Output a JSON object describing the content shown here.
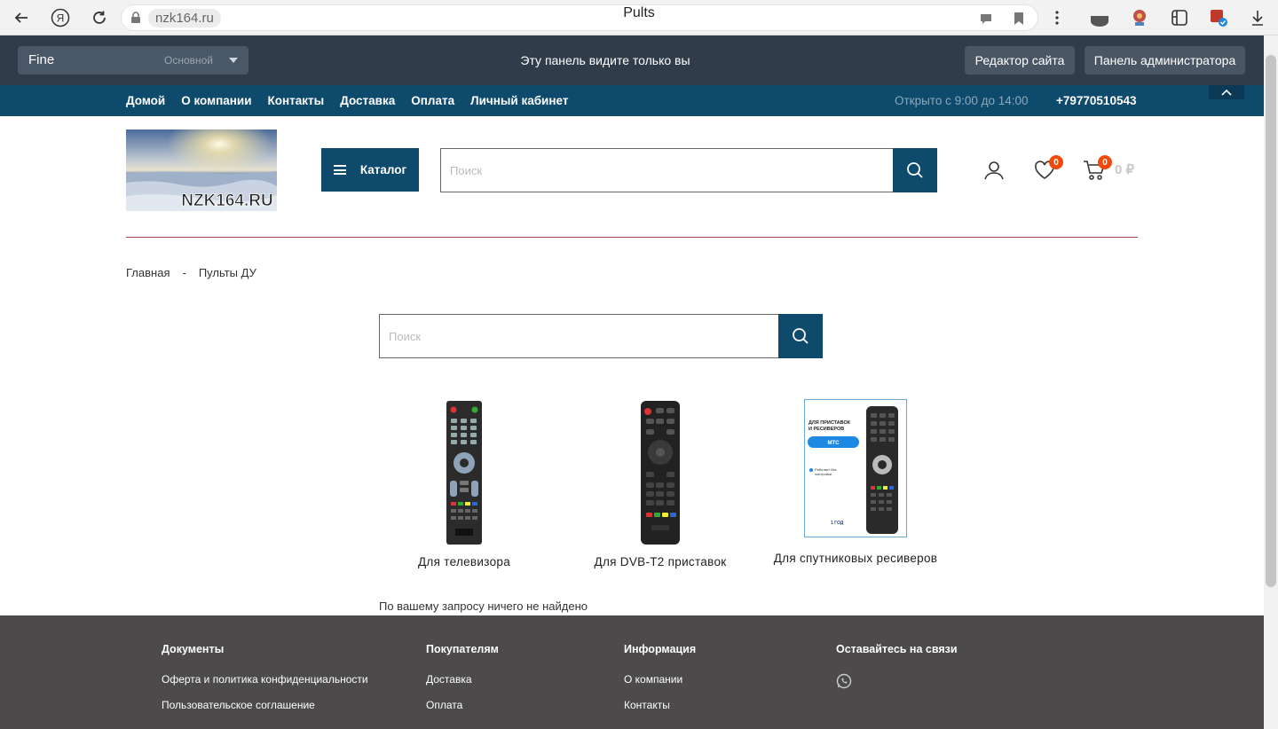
{
  "browser": {
    "domain": "nzk164.ru",
    "tab_title": "Pults"
  },
  "admin_bar": {
    "site_name": "Fine",
    "site_variant": "Основной",
    "message": "Эту панель видите только вы",
    "editor_button": "Редактор сайта",
    "admin_button": "Панель администратора"
  },
  "nav": {
    "links": [
      "Домой",
      "О компании",
      "Контакты",
      "Доставка",
      "Оплата",
      "Личный кабинет"
    ],
    "hours": "Открыто с 9:00 до 14:00",
    "phone": "+79770510543"
  },
  "header": {
    "logo_text": "NZK164.RU",
    "catalog_label": "Каталог",
    "search_placeholder": "Поиск",
    "wishlist_count": "0",
    "cart_count": "0",
    "cart_total": "0 ₽"
  },
  "breadcrumb": {
    "home": "Главная",
    "separator": "-",
    "current": "Пульты ДУ"
  },
  "category_search": {
    "placeholder": "Поиск"
  },
  "categories": [
    {
      "label": "Для телевизора"
    },
    {
      "label": "Для DVB-T2 приставок"
    },
    {
      "label": "Для спутниковых ресиверов"
    }
  ],
  "mts_card": {
    "line1": "ДЛЯ ПРИСТАВОК",
    "line2": "И РЕСИВЕРОВ",
    "brand": "МТС",
    "note1": "Работает без",
    "note2": "настройки",
    "warranty": "1 ГОД"
  },
  "not_found": "По вашему запросу ничего не найдено",
  "footer": {
    "columns": [
      {
        "title": "Документы",
        "items": [
          "Оферта и политика конфиденциальности",
          "Пользовательское соглашение"
        ]
      },
      {
        "title": "Покупателям",
        "items": [
          "Доставка",
          "Оплата"
        ]
      },
      {
        "title": "Информация",
        "items": [
          "О компании",
          "Контакты"
        ]
      },
      {
        "title": "Оставайтесь на связи",
        "items": []
      }
    ]
  },
  "colors": {
    "brand": "#0e4a6c",
    "admin_bg": "#303c4a",
    "badge": "#f04a0c",
    "footer_bg": "#4c4a4a"
  }
}
